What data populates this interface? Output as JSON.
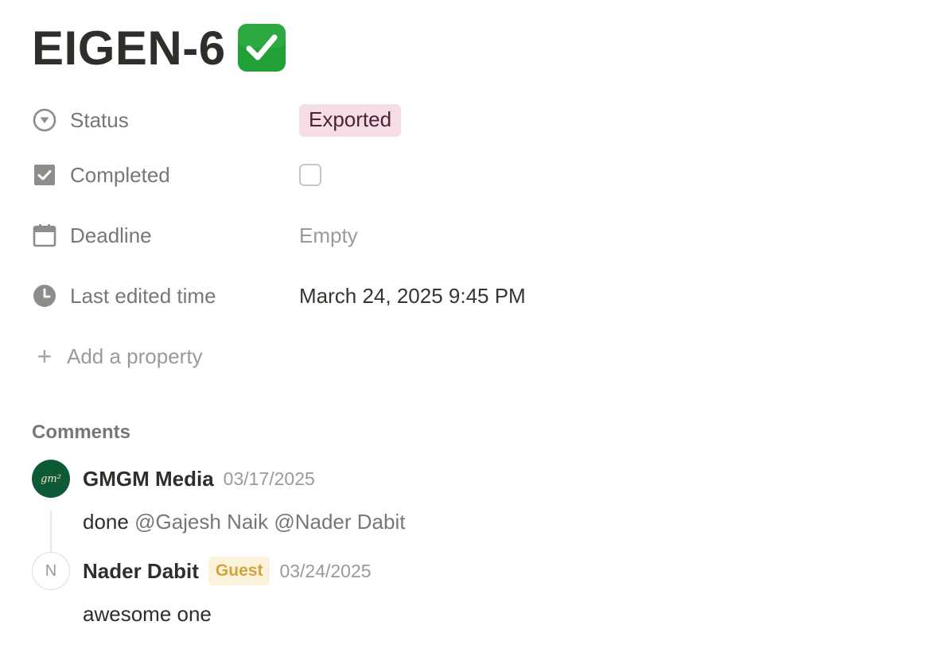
{
  "page": {
    "title": "EIGEN-6",
    "title_emoji": "check-mark-button-emoji"
  },
  "properties": {
    "status": {
      "label": "Status",
      "value": "Exported",
      "icon": "status-icon",
      "pill_color": "#f5dde6"
    },
    "completed": {
      "label": "Completed",
      "checked": false,
      "icon": "checkbox-icon"
    },
    "deadline": {
      "label": "Deadline",
      "value": "Empty",
      "icon": "calendar-icon"
    },
    "last_edited": {
      "label": "Last edited time",
      "value": "March 24, 2025 9:45 PM",
      "icon": "clock-icon"
    },
    "add_property": "Add a property"
  },
  "comments": {
    "title": "Comments",
    "items": [
      {
        "author": "GMGM Media",
        "avatar_text": "gm²",
        "date": "03/17/2025",
        "text": "done",
        "mentions": [
          "@Gajesh Naik",
          "@Nader Dabit"
        ]
      },
      {
        "author": "Nader Dabit",
        "avatar_text": "N",
        "badge": "Guest",
        "date": "03/24/2025",
        "text": "awesome one"
      }
    ]
  },
  "colors": {
    "accent_green": "#21a038",
    "guest_badge_bg": "#fbf2dc",
    "guest_badge_text": "#d1a43c"
  }
}
